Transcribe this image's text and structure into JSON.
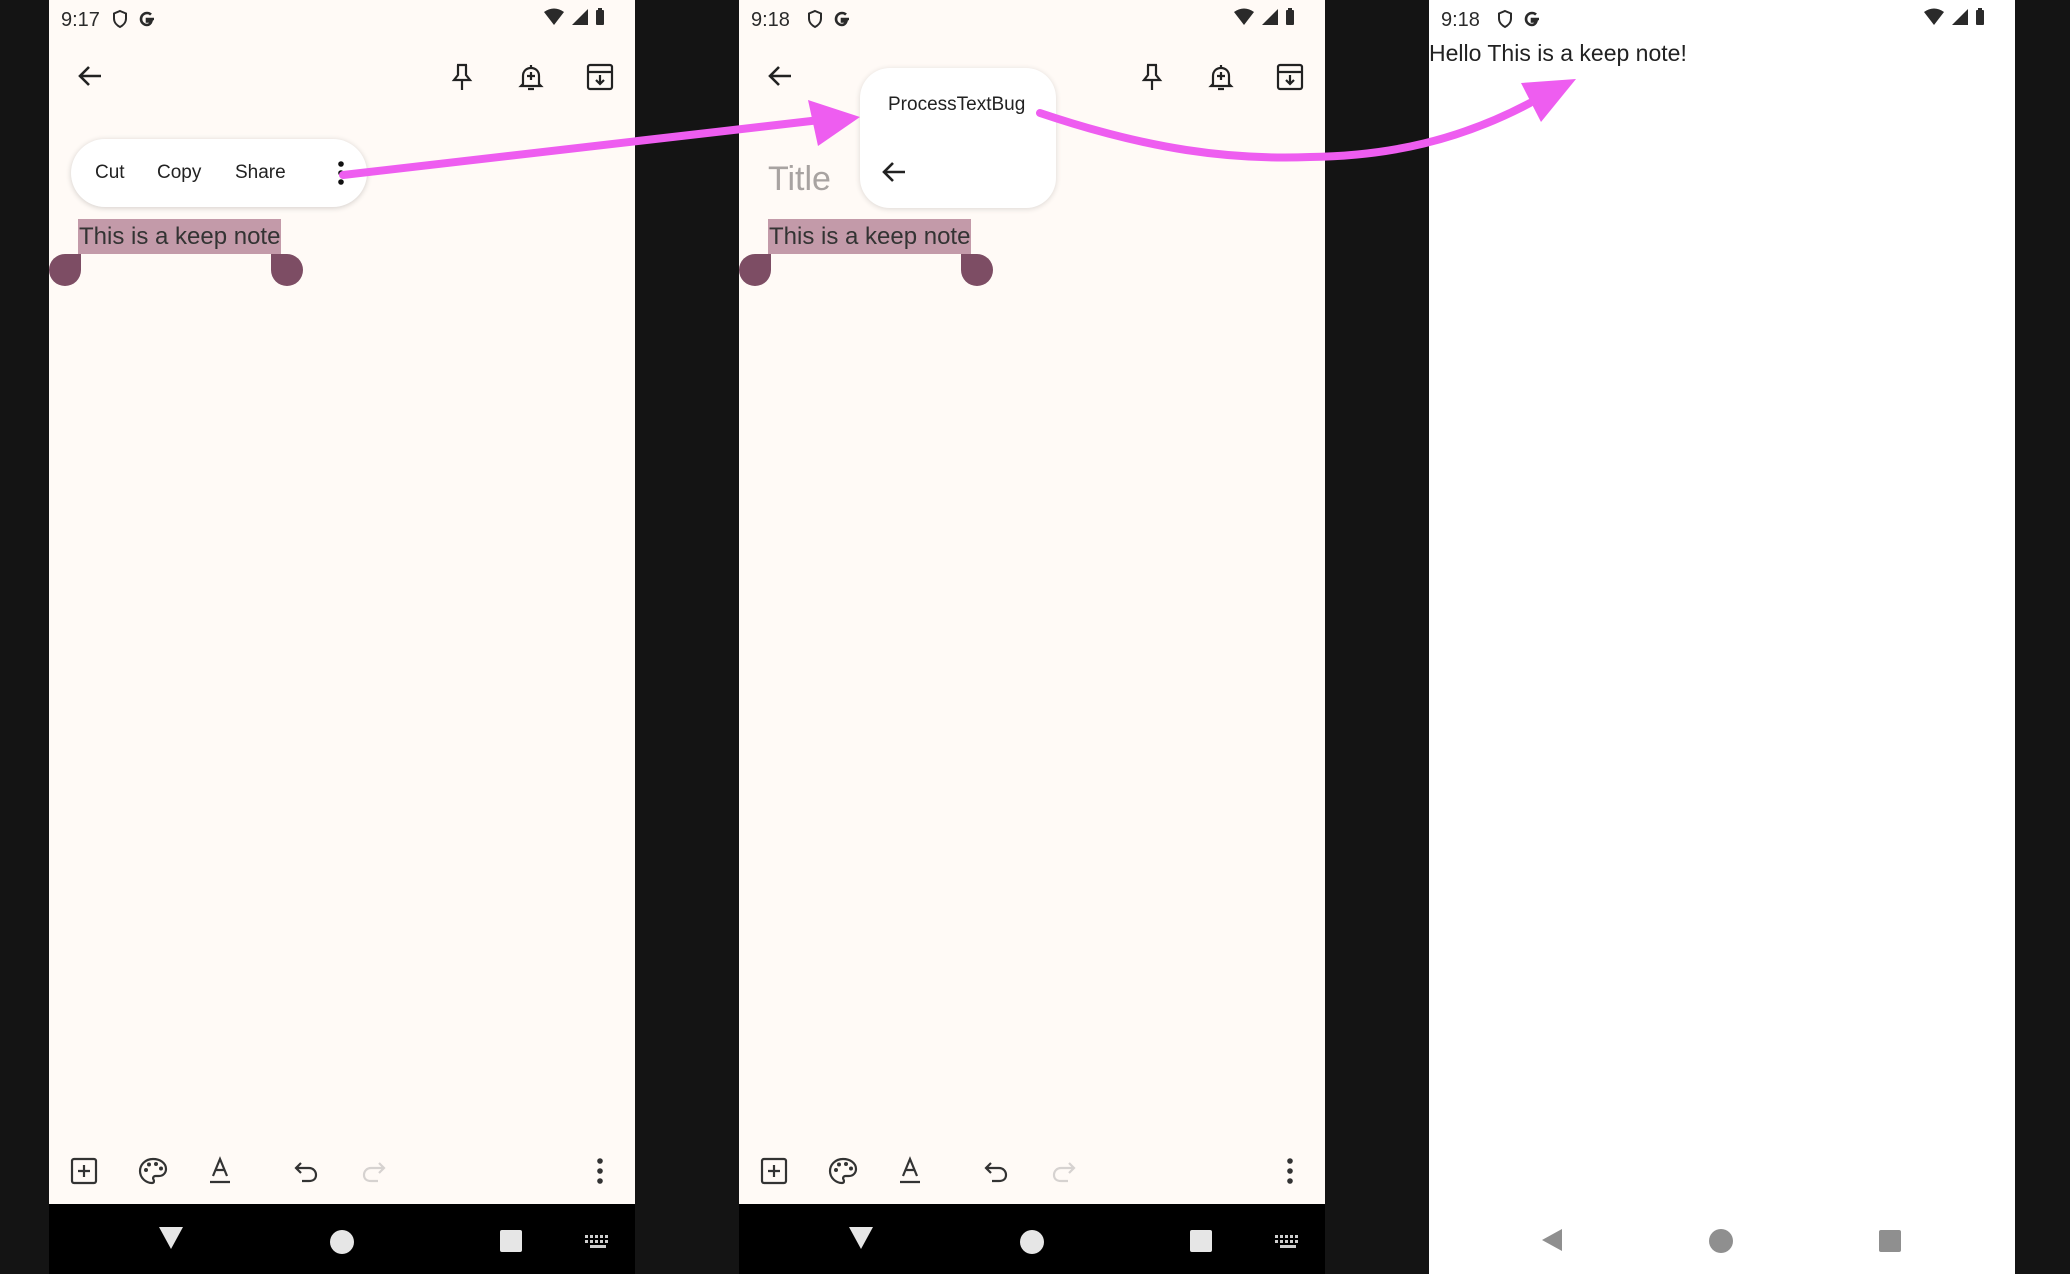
{
  "screen1": {
    "time": "9:17",
    "menu": {
      "cut": "Cut",
      "copy": "Copy",
      "share": "Share"
    },
    "selected_text": "This is a keep note"
  },
  "screen2": {
    "time": "9:18",
    "popup_item": "ProcessTextBug",
    "title_placeholder": "Title",
    "selected_text": "This is a keep note"
  },
  "screen3": {
    "time": "9:18",
    "result_text": "Hello This is a keep note!"
  },
  "colors": {
    "selection": "#c39aa9",
    "handle": "#7d4d64",
    "arrow": "#ee5df0",
    "keep_background": "#fffaf6"
  },
  "icons": [
    "back-arrow-icon",
    "pin-icon",
    "reminder-bell-icon",
    "archive-icon",
    "add-box-icon",
    "palette-icon",
    "text-format-icon",
    "undo-icon",
    "redo-icon",
    "more-vert-icon",
    "nav-back-icon",
    "nav-home-icon",
    "nav-recents-icon",
    "keyboard-icon"
  ]
}
